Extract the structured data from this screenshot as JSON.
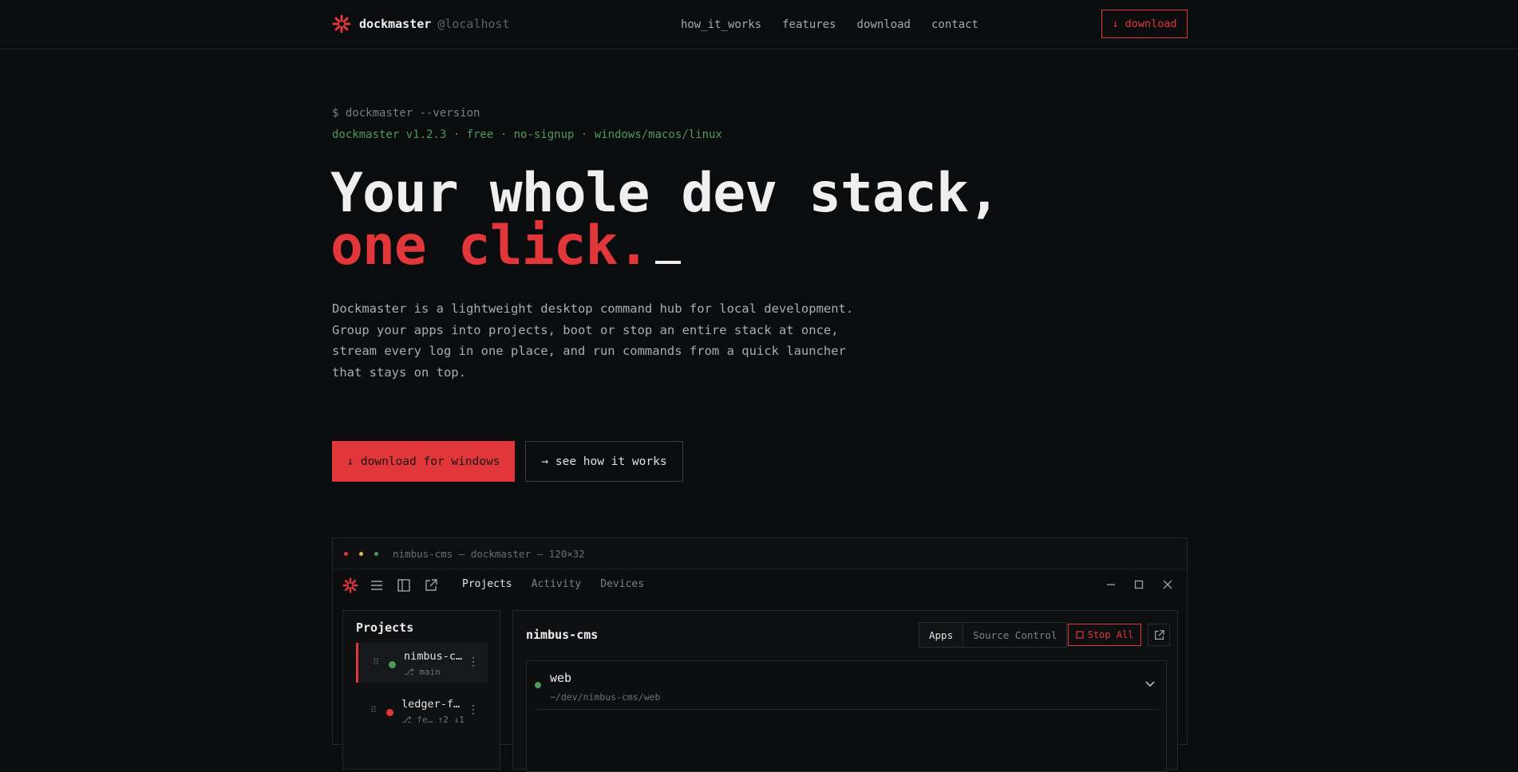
{
  "colors": {
    "accent": "#e2373a",
    "success": "#4e9a59",
    "bg": "#0b0c0e",
    "warning": "#e5b84a"
  },
  "nav": {
    "brand_icon": "asterisk-logo-icon",
    "brand_name": "dockmaster",
    "brand_host": "@localhost",
    "links": [
      "how_it_works",
      "features",
      "download",
      "contact"
    ],
    "cta_label": "↓ download"
  },
  "hero": {
    "prompt": "$ dockmaster --version",
    "version_line": "dockmaster v1.2.3 · free · no-signup · windows/macos/linux",
    "headline_line1": "Your whole dev stack,",
    "headline_line2": "one click.",
    "lead": "Dockmaster is a lightweight desktop command hub for local development. Group your apps into projects, boot or stop an entire stack at once, stream every log in one place, and run commands from a quick launcher that stays on top.",
    "primary_button": "↓ download for windows",
    "secondary_button": "→ see how it works"
  },
  "window": {
    "title": "nimbus-cms — dockmaster — 120×32",
    "tabs": [
      "Projects",
      "Activity",
      "Devices"
    ],
    "active_tab": "Projects",
    "sidebar": {
      "title": "Projects",
      "items": [
        {
          "name": "nimbus-c…",
          "branch": "⎇ main",
          "status": "running"
        },
        {
          "name": "ledger-f…",
          "branch": "⎇ fe… ↑2 ↓1",
          "status": "stopped"
        }
      ]
    },
    "panel": {
      "title": "nimbus-cms",
      "segments": [
        "Apps",
        "Source Control"
      ],
      "stop_all": "Stop All",
      "apps": [
        {
          "name": "web",
          "path": "~/dev/nimbus-cms/web"
        }
      ]
    }
  }
}
